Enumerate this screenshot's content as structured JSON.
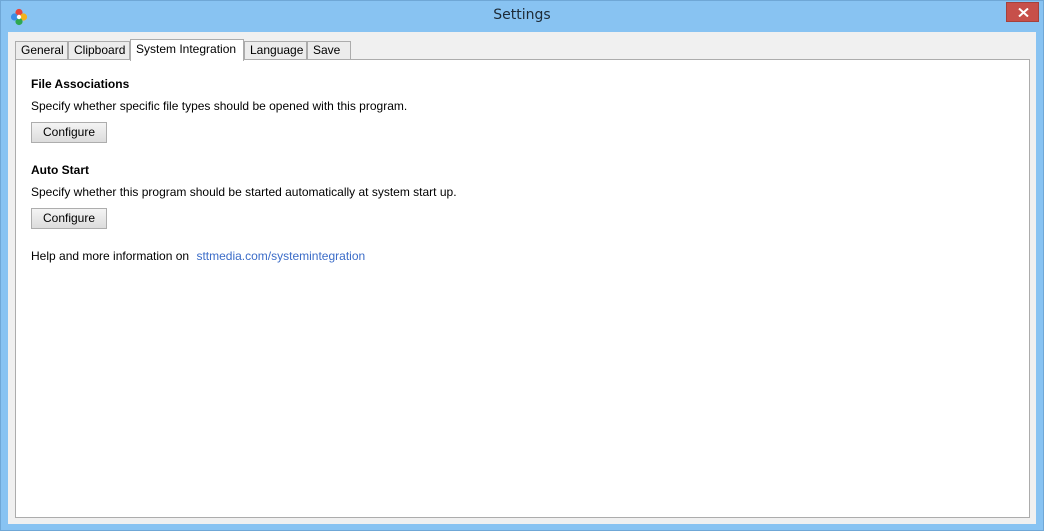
{
  "window": {
    "title": "Settings"
  },
  "tabs": [
    {
      "label": "General",
      "active": false
    },
    {
      "label": "Clipboard",
      "active": false
    },
    {
      "label": "System Integration",
      "active": true
    },
    {
      "label": "Language",
      "active": false
    },
    {
      "label": "Save",
      "active": false
    }
  ],
  "sections": {
    "file_associations": {
      "heading": "File Associations",
      "description": "Specify whether specific file types should be opened with this program.",
      "button": "Configure"
    },
    "auto_start": {
      "heading": "Auto Start",
      "description": "Specify whether this program should be started automatically at system start up.",
      "button": "Configure"
    }
  },
  "help": {
    "text": "Help and more information on",
    "link": "sttmedia.com/systemintegration"
  },
  "icons": {
    "app": "app-flower-icon",
    "close": "close-icon"
  },
  "colors": {
    "titlebar": "#88c3f2",
    "close": "#c7504a",
    "link": "#3b6cc8"
  }
}
